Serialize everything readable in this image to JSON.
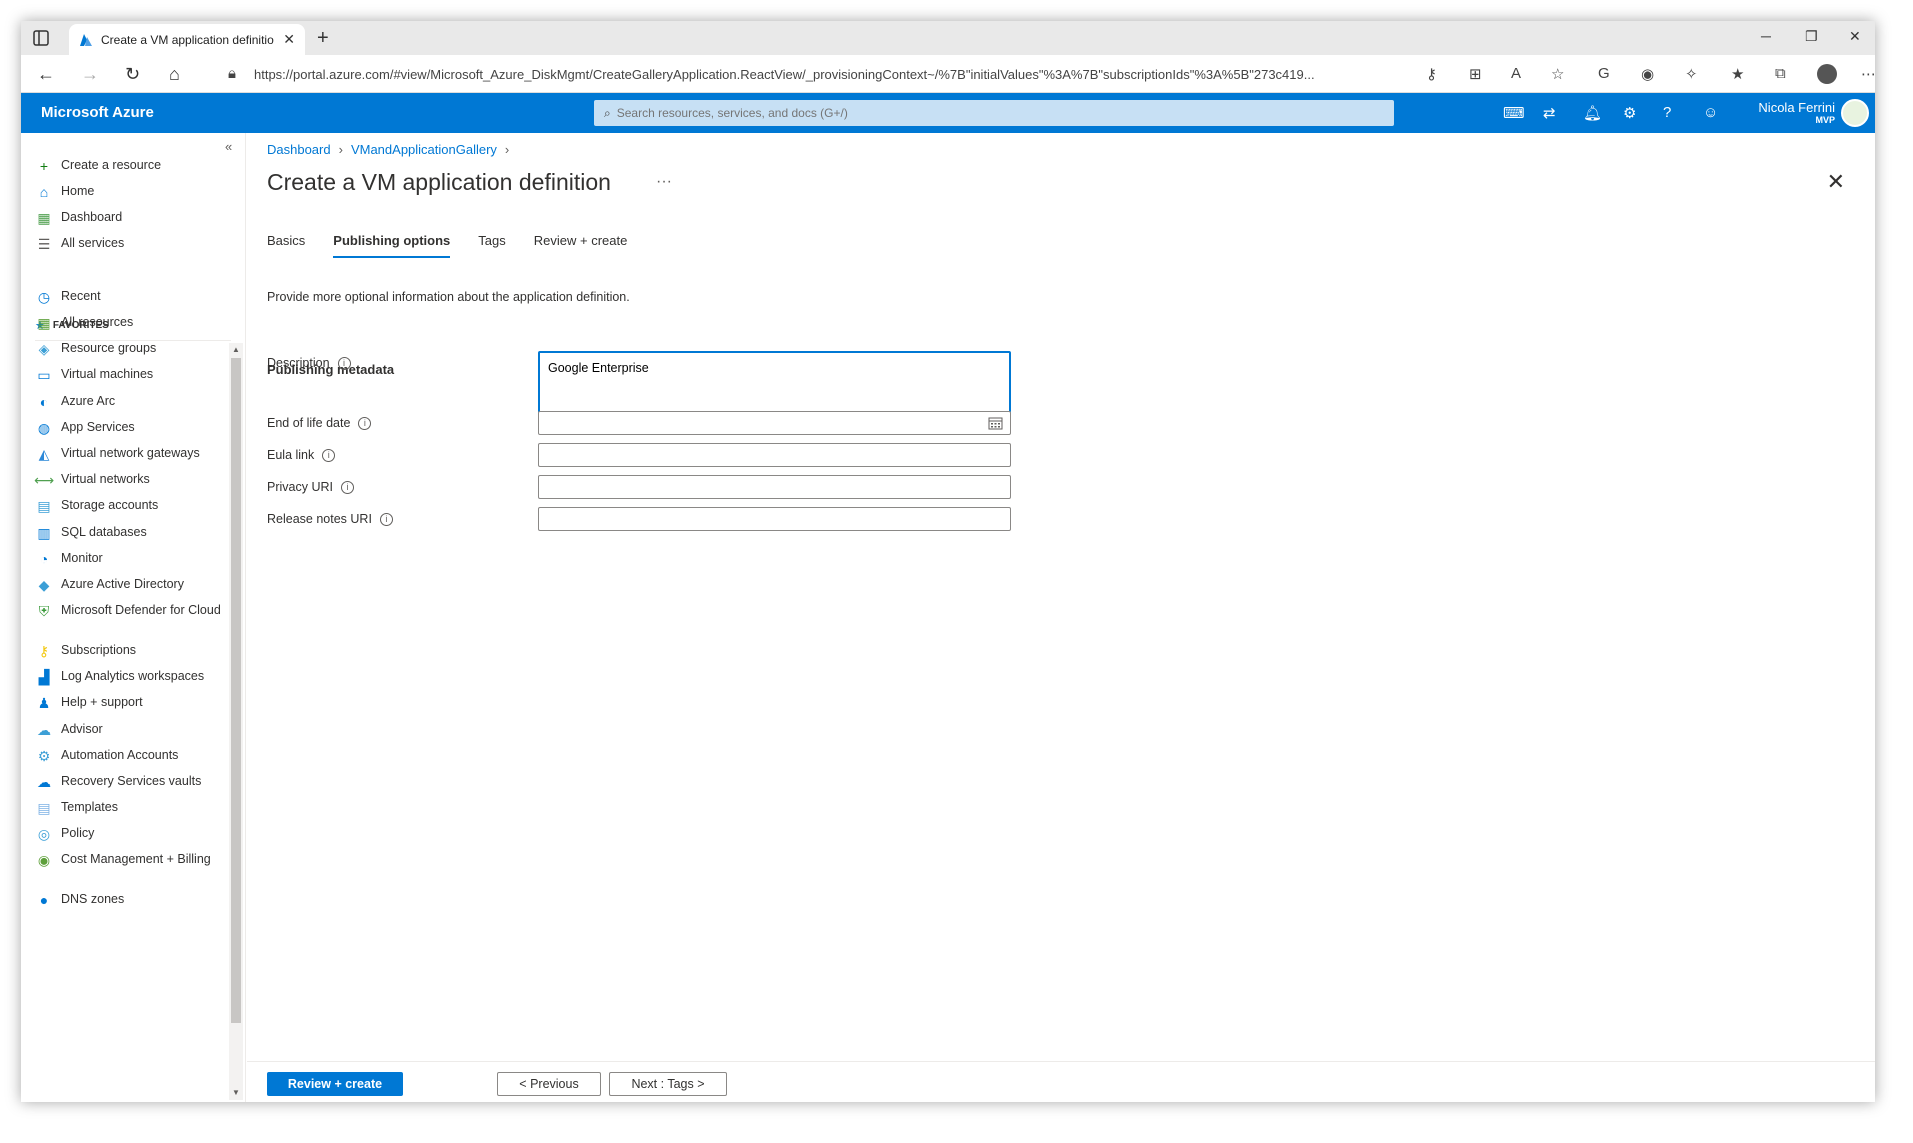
{
  "browser": {
    "tab_title": "Create a VM application definitio",
    "url": "https://portal.azure.com/#view/Microsoft_Azure_DiskMgmt/CreateGalleryApplication.ReactView/_provisioningContext~/%7B\"initialValues\"%3A%7B\"subscriptionIds\"%3A%5B\"273c419..."
  },
  "azure": {
    "brand": "Microsoft Azure",
    "search_placeholder": "Search resources, services, and docs (G+/)",
    "user_name": "Nicola Ferrini",
    "user_badge": "MVP"
  },
  "sidenav": {
    "top_items": [
      {
        "label": "Create a resource",
        "icon": "plus-icon"
      },
      {
        "label": "Home",
        "icon": "home-icon"
      },
      {
        "label": "Dashboard",
        "icon": "dashboard-icon"
      },
      {
        "label": "All services",
        "icon": "list-icon"
      }
    ],
    "favorites_label": "FAVORITES",
    "favorites": [
      {
        "label": "Recent",
        "icon": "clock-icon"
      },
      {
        "label": "All resources",
        "icon": "grid-icon"
      },
      {
        "label": "Resource groups",
        "icon": "cube-icon"
      },
      {
        "label": "Virtual machines",
        "icon": "monitor-icon"
      },
      {
        "label": "Azure Arc",
        "icon": "arc-icon"
      },
      {
        "label": "App Services",
        "icon": "globe-icon"
      },
      {
        "label": "Virtual network gateways",
        "icon": "lock-icon"
      },
      {
        "label": "Virtual networks",
        "icon": "network-icon"
      },
      {
        "label": "Storage accounts",
        "icon": "storage-icon"
      },
      {
        "label": "SQL databases",
        "icon": "database-icon"
      },
      {
        "label": "Monitor",
        "icon": "gauge-icon"
      },
      {
        "label": "Azure Active Directory",
        "icon": "diamond-icon"
      },
      {
        "label": "Microsoft Defender for Cloud",
        "icon": "shield-icon"
      },
      {
        "label": "Subscriptions",
        "icon": "key-icon"
      },
      {
        "label": "Log Analytics workspaces",
        "icon": "analytics-icon"
      },
      {
        "label": "Help + support",
        "icon": "person-icon"
      },
      {
        "label": "Advisor",
        "icon": "cloud-icon"
      },
      {
        "label": "Automation Accounts",
        "icon": "gear-icon"
      },
      {
        "label": "Recovery Services vaults",
        "icon": "cloud-backup-icon"
      },
      {
        "label": "Templates",
        "icon": "template-icon"
      },
      {
        "label": "Policy",
        "icon": "policy-icon"
      },
      {
        "label": "Cost Management + Billing",
        "icon": "cost-icon"
      },
      {
        "label": "DNS zones",
        "icon": "dns-icon"
      }
    ]
  },
  "main": {
    "breadcrumb": [
      "Dashboard",
      "VMandApplicationGallery"
    ],
    "title": "Create a VM application definition",
    "tabs": [
      "Basics",
      "Publishing options",
      "Tags",
      "Review + create"
    ],
    "active_tab": "Publishing options",
    "intro": "Provide more optional information about the application definition.",
    "section_title": "Publishing metadata",
    "fields": {
      "description": {
        "label": "Description",
        "value": "Google Enterprise"
      },
      "end_of_life": {
        "label": "End of life date",
        "value": ""
      },
      "eula": {
        "label": "Eula link",
        "value": ""
      },
      "privacy": {
        "label": "Privacy URI",
        "value": ""
      },
      "release_notes": {
        "label": "Release notes URI",
        "value": ""
      }
    }
  },
  "footer": {
    "review_create": "Review + create",
    "previous": "< Previous",
    "next": "Next : Tags >"
  },
  "colors": {
    "accent": "#0078d4",
    "search_bg": "#c7e0f4"
  }
}
